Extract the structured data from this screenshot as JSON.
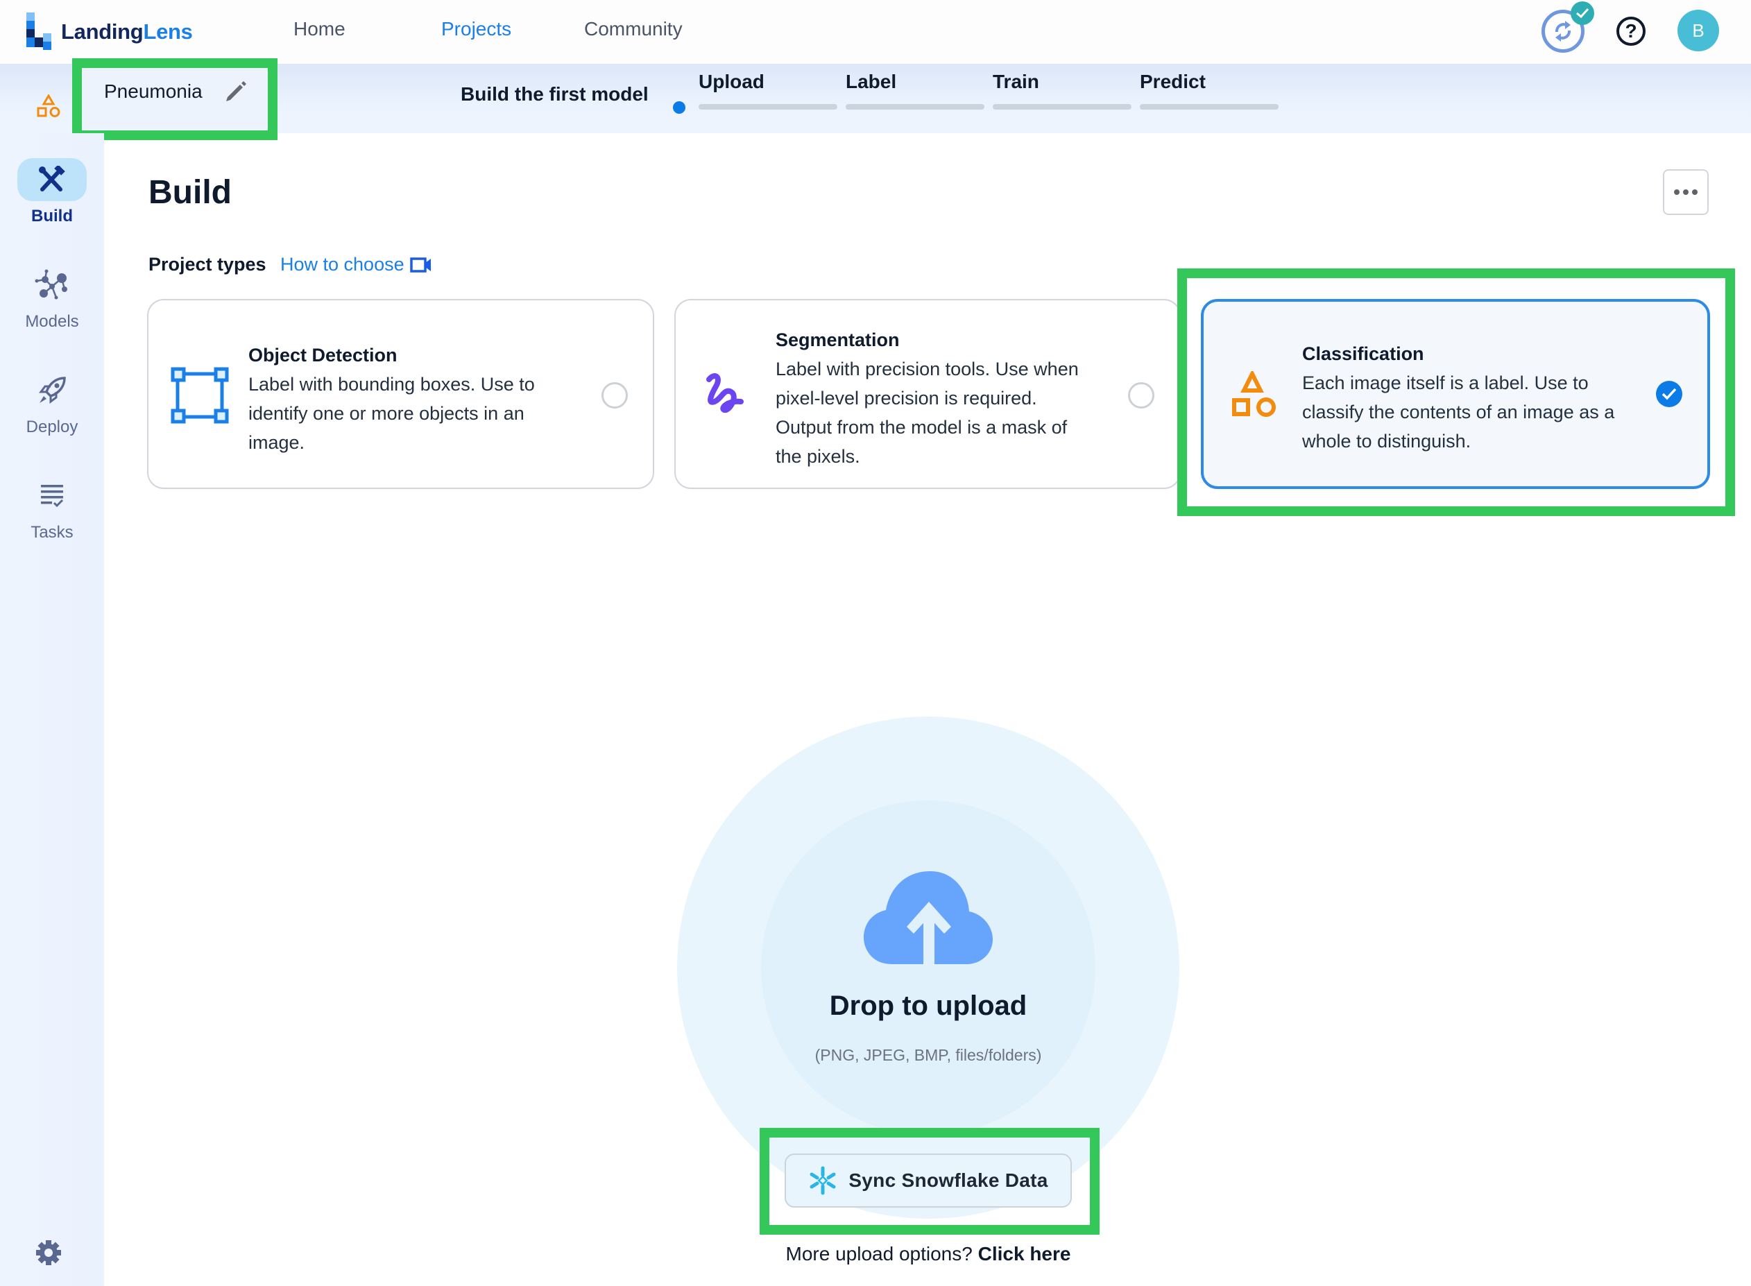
{
  "app": {
    "logo_part1": "Landing",
    "logo_part2": "Lens",
    "nav": [
      {
        "label": "Home",
        "active": false
      },
      {
        "label": "Projects",
        "active": true
      },
      {
        "label": "Community",
        "active": false
      }
    ],
    "avatar_initial": "B",
    "help_glyph": "?"
  },
  "project": {
    "name": "Pneumonia",
    "type_icon": "classification-shapes-icon"
  },
  "progress": {
    "title": "Build the first model",
    "current_step": 0,
    "steps": [
      {
        "label": "Upload"
      },
      {
        "label": "Label"
      },
      {
        "label": "Train"
      },
      {
        "label": "Predict"
      }
    ]
  },
  "sidebar": {
    "items": [
      {
        "label": "Build",
        "icon": "build-tools-icon",
        "active": true
      },
      {
        "label": "Models",
        "icon": "models-network-icon",
        "active": false
      },
      {
        "label": "Deploy",
        "icon": "rocket-icon",
        "active": false
      },
      {
        "label": "Tasks",
        "icon": "tasks-list-icon",
        "active": false
      }
    ],
    "settings_icon": "gear-icon"
  },
  "main": {
    "title": "Build",
    "project_types_label": "Project types",
    "how_to_choose": "How to choose",
    "cards": [
      {
        "title": "Object Detection",
        "description": "Label with bounding boxes. Use to identify one or more objects in an image.",
        "icon": "bounding-box-icon",
        "selected": false
      },
      {
        "title": "Segmentation",
        "description": "Label with precision tools. Use when pixel-level precision is required. Output from the model is a mask of the pixels.",
        "icon": "squiggle-brush-icon",
        "selected": false
      },
      {
        "title": "Classification",
        "description": "Each image itself is a label. Use to classify the contents of an image as a whole to distinguish.",
        "icon": "shapes-icon",
        "selected": true
      }
    ]
  },
  "upload": {
    "title": "Drop to upload",
    "formats": "(PNG, JPEG, BMP, files/folders)",
    "snowflake_button": "Sync Snowflake Data",
    "more_options_prefix": "More upload options?",
    "more_options_link": "Click here"
  },
  "colors": {
    "accent": "#1a7fe6",
    "highlight": "#34c759",
    "classification": "#f28c0f",
    "segmentation": "#6b46f0",
    "selected_border": "#2c8be6"
  }
}
